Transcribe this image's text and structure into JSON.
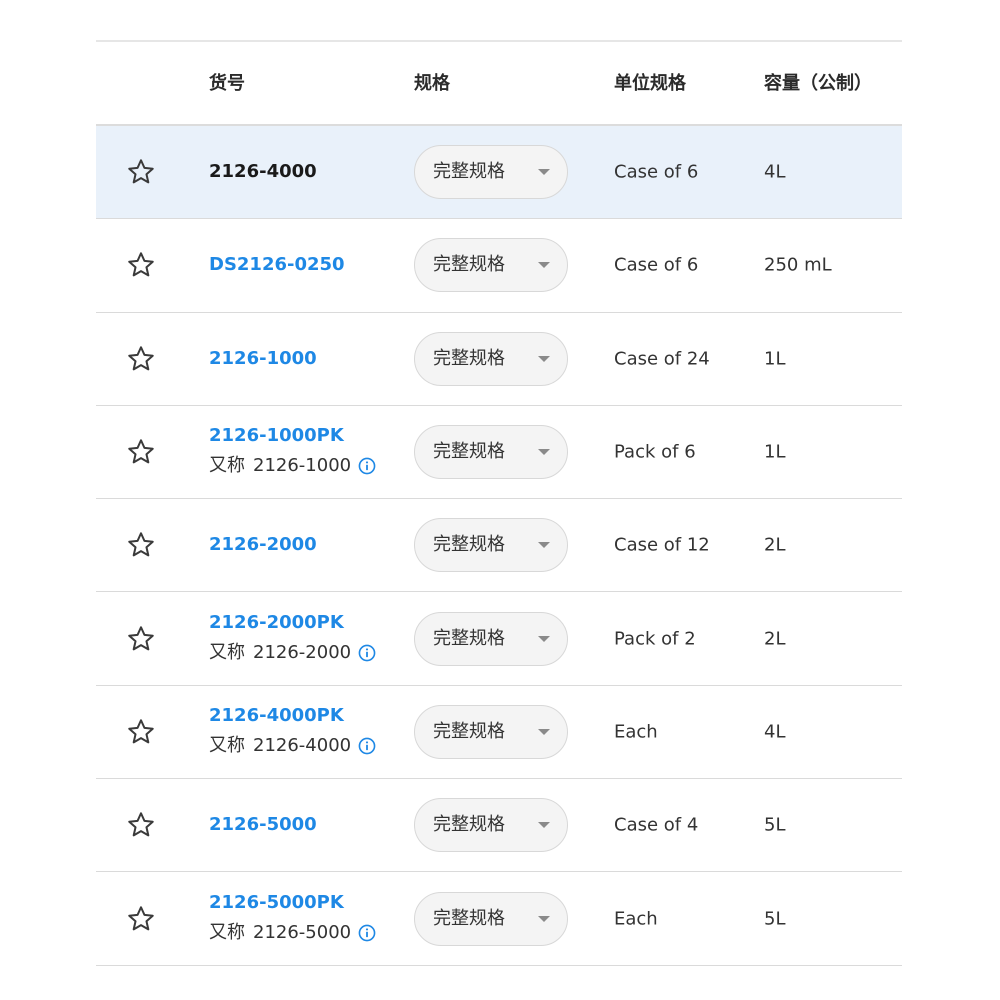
{
  "header": {
    "part_number": "货号",
    "spec": "规格",
    "unit": "单位规格",
    "capacity": "容量（公制）"
  },
  "alias_prefix": "又称",
  "rows": [
    {
      "part": "2126-4000",
      "current": true,
      "alias": "",
      "spec": "完整规格",
      "unit": "Case of 6",
      "capacity": "4L"
    },
    {
      "part": "DS2126-0250",
      "current": false,
      "alias": "",
      "spec": "完整规格",
      "unit": "Case of 6",
      "capacity": "250 mL"
    },
    {
      "part": "2126-1000",
      "current": false,
      "alias": "",
      "spec": "完整规格",
      "unit": "Case of 24",
      "capacity": "1L"
    },
    {
      "part": "2126-1000PK",
      "current": false,
      "alias": "2126-1000",
      "spec": "完整规格",
      "unit": "Pack of 6",
      "capacity": "1L"
    },
    {
      "part": "2126-2000",
      "current": false,
      "alias": "",
      "spec": "完整规格",
      "unit": "Case of 12",
      "capacity": "2L"
    },
    {
      "part": "2126-2000PK",
      "current": false,
      "alias": "2126-2000",
      "spec": "完整规格",
      "unit": "Pack of 2",
      "capacity": "2L"
    },
    {
      "part": "2126-4000PK",
      "current": false,
      "alias": "2126-4000",
      "spec": "完整规格",
      "unit": "Each",
      "capacity": "4L"
    },
    {
      "part": "2126-5000",
      "current": false,
      "alias": "",
      "spec": "完整规格",
      "unit": "Case of 4",
      "capacity": "5L"
    },
    {
      "part": "2126-5000PK",
      "current": false,
      "alias": "2126-5000",
      "spec": "完整规格",
      "unit": "Each",
      "capacity": "5L"
    }
  ],
  "icons": {
    "favorite": "star-outline-icon",
    "info": "info-circle-icon",
    "dropdown": "chevron-down-icon"
  },
  "colors": {
    "link": "#1e88e5",
    "highlight_row": "#e9f1fa",
    "border": "#dadada"
  }
}
